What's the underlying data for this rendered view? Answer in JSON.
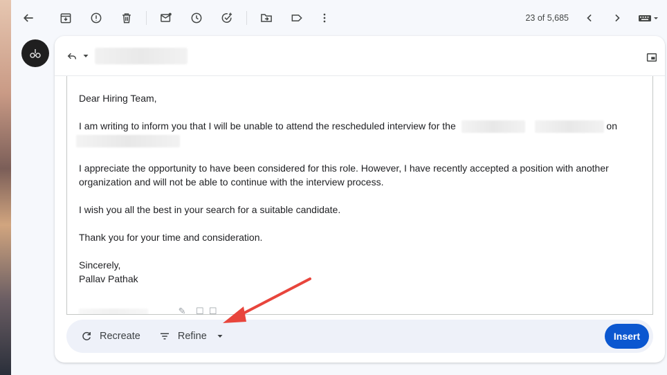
{
  "toolbar": {
    "count_label": "23 of 5,685",
    "icons": [
      "back-arrow-icon",
      "archive-icon",
      "report-spam-icon",
      "delete-icon",
      "mark-unread-icon",
      "snooze-icon",
      "add-task-icon",
      "move-to-icon",
      "label-icon",
      "more-vert-icon",
      "older-icon",
      "newer-icon",
      "input-tools-icon"
    ]
  },
  "message": {
    "greeting": "Dear Hiring Team,",
    "para1": "I am writing to inform you that I will be unable to attend the rescheduled interview for the",
    "para1_tail": "on",
    "para2": "I appreciate the opportunity to have been considered for this role. However, I have recently accepted a position with another organization and will not be able to continue with the interview process.",
    "para3": "I wish you all the best in your search for a suitable candidate.",
    "para4": "Thank you for your time and consideration.",
    "closing": "Sincerely,",
    "signature": "Pallav Pathak"
  },
  "help_me_write": {
    "recreate_label": "Recreate",
    "refine_label": "Refine",
    "insert_label": "Insert"
  },
  "colors": {
    "accent": "#0b57d0",
    "arrow": "#e8453c"
  }
}
